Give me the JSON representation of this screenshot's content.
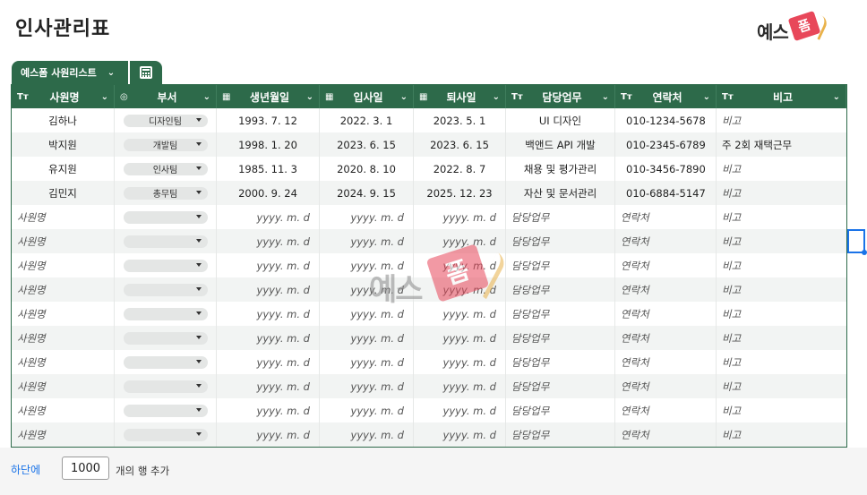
{
  "page": {
    "title": "인사관리표"
  },
  "brand": {
    "logo_text": "예스",
    "logo_badge": "폼",
    "accent": "#e8475a",
    "sheet_color": "#2d6a4a"
  },
  "tabs": {
    "sheet_tab_label": "예스폼 사원리스트",
    "chevron_icon": "chevron-down-icon",
    "calc_icon": "calculator-icon"
  },
  "columns": [
    {
      "label": "사원명",
      "icon": "Tт"
    },
    {
      "label": "부서",
      "icon": "◎"
    },
    {
      "label": "생년월일",
      "icon": "▦"
    },
    {
      "label": "입사일",
      "icon": "▦"
    },
    {
      "label": "퇴사일",
      "icon": "▦"
    },
    {
      "label": "담당업무",
      "icon": "Tт"
    },
    {
      "label": "연락처",
      "icon": "Tт"
    },
    {
      "label": "비고",
      "icon": "Tт"
    }
  ],
  "rows": [
    {
      "name": "김하나",
      "dept": "디자인팀",
      "birth": "1993. 7. 12",
      "join": "2022. 3. 1",
      "leave": "2023. 5. 1",
      "task": "UI 디자인",
      "phone": "010-1234-5678",
      "note": "비고",
      "note_placeholder": true
    },
    {
      "name": "박지원",
      "dept": "개발팀",
      "birth": "1998. 1. 20",
      "join": "2023. 6. 15",
      "leave": "2023. 6. 15",
      "task": "백앤드 API 개발",
      "phone": "010-2345-6789",
      "note": "주 2회 재택근무",
      "note_placeholder": false
    },
    {
      "name": "유지원",
      "dept": "인사팀",
      "birth": "1985. 11. 3",
      "join": "2020. 8. 10",
      "leave": "2022. 8. 7",
      "task": "채용 및 평가관리",
      "phone": "010-3456-7890",
      "note": "비고",
      "note_placeholder": true
    },
    {
      "name": "김민지",
      "dept": "총무팀",
      "birth": "2000. 9. 24",
      "join": "2024. 9. 15",
      "leave": "2025. 12. 23",
      "task": "자산 및 문서관리",
      "phone": "010-6884-5147",
      "note": "비고",
      "note_placeholder": true
    }
  ],
  "placeholders": {
    "name": "사원명",
    "date": "yyyy. m. d",
    "task": "담당업무",
    "phone": "연락처",
    "note": "비고",
    "empty_row_count": 10
  },
  "watermark": {
    "text": "예스",
    "badge": "폼"
  },
  "footer": {
    "add_link": "하단에",
    "row_count_value": "1000",
    "suffix": "개의 행 추가"
  }
}
